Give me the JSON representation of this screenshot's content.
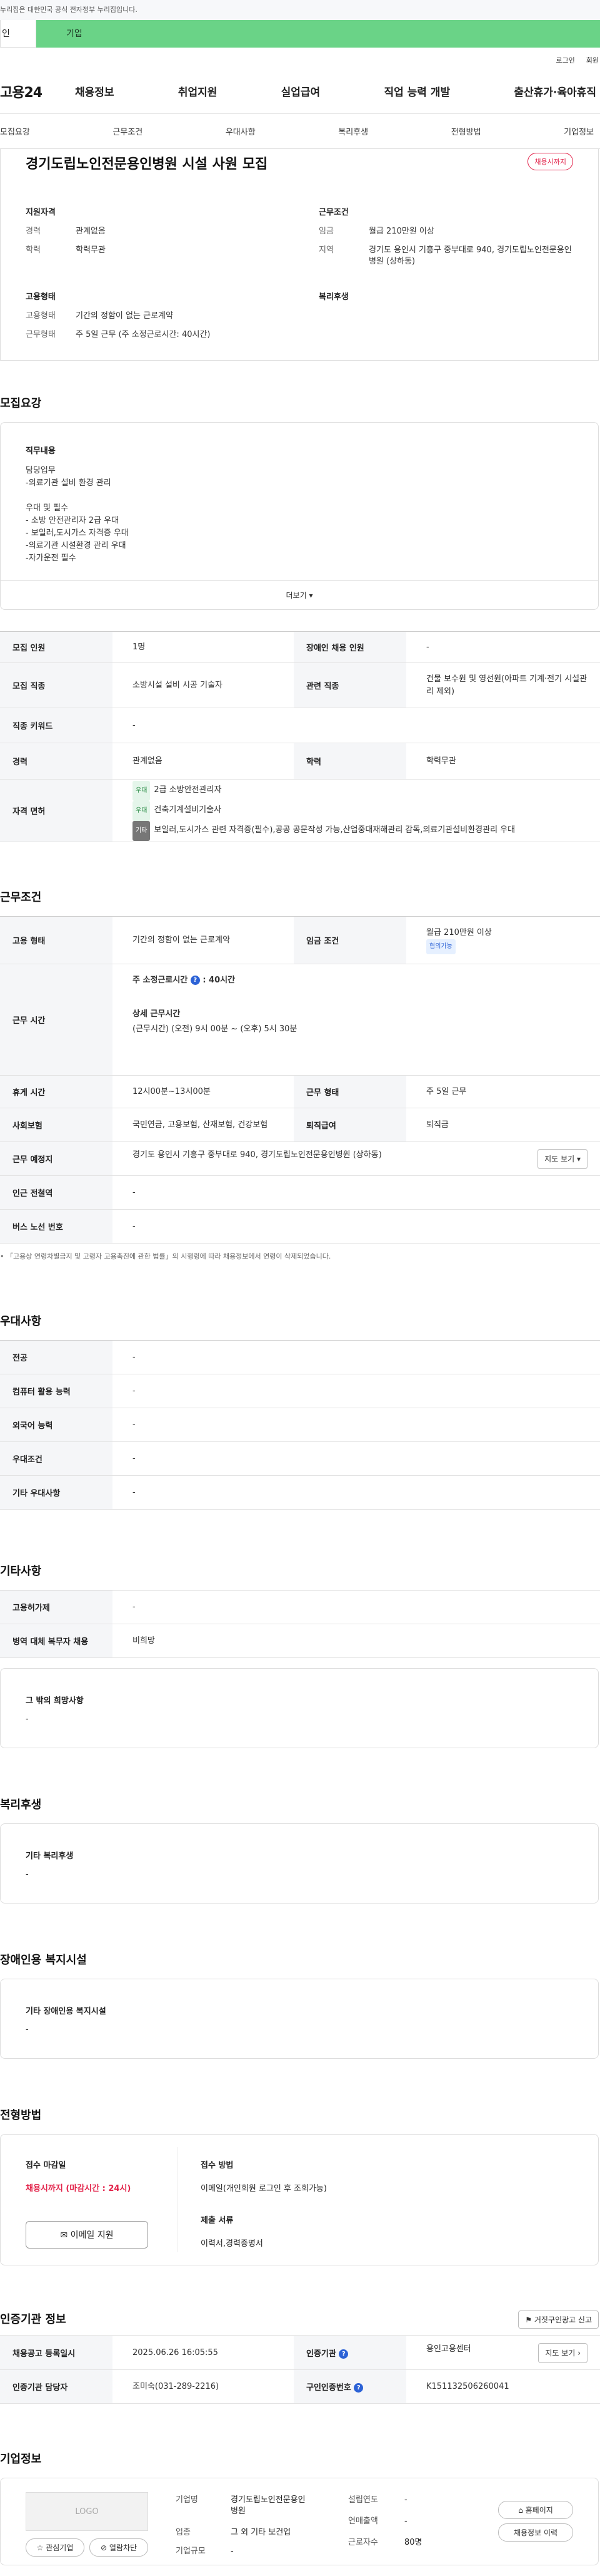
{
  "notice": "누리집은 대한민국 공식 전자정부 누리집입니다.",
  "user_tabs": [
    "인",
    "기업"
  ],
  "util_links": [
    "로그인",
    "회원"
  ],
  "logo": "고용24",
  "gnb": [
    "채용정보",
    "취업지원",
    "실업급여",
    "직업 능력 개발",
    "출산휴가·육아휴직"
  ],
  "subnav": [
    "모집요강",
    "근무조건",
    "우대사항",
    "복리후생",
    "전형방법",
    "기업정보"
  ],
  "job": {
    "title": "경기도립노인전문용인병원 시설 사원 모집",
    "status": "채용시까지",
    "qual_heading": "지원자격",
    "qual": [
      {
        "k": "경력",
        "v": "관계없음"
      },
      {
        "k": "학력",
        "v": "학력무관"
      }
    ],
    "cond_heading": "근무조건",
    "cond": [
      {
        "k": "임금",
        "v": "월급 210만원 이상"
      },
      {
        "k": "지역",
        "v": "경기도 용인시 기흥구 중부대로 940, 경기도립노인전문용인병원 (상하동)"
      }
    ],
    "emp_heading": "고용형태",
    "emp": [
      {
        "k": "고용형태",
        "v": "기간의 정함이 없는 근로계약"
      },
      {
        "k": "근무형태",
        "v": "주 5일 근무 (주 소정근로시간: 40시간)"
      }
    ],
    "welfare_heading": "복리후생"
  },
  "recruit": {
    "heading": "모집요강",
    "duty_label": "직무내용",
    "duty_lines": [
      "담당업무",
      "-의료기관 설비 환경 관리",
      "",
      "우대 및 필수",
      "- 소방 안전관리자 2급 우대",
      "- 보일러,도시가스 자격증 우대",
      "-의료기관 시설환경 관리 우대",
      "-자가운전 필수"
    ],
    "more": "더보기",
    "rows": {
      "headcount_k": "모집 인원",
      "headcount_v": "1명",
      "disabled_k": "장애인 채용 인원",
      "disabled_v": "-",
      "job_k": "모집 직종",
      "job_v": "소방시설 설비 시공 기술자",
      "rel_k": "관련 직종",
      "rel_v": "건물 보수원 및 영선원(아파트 기계·전기 시설관리 제외)",
      "kw_k": "직종 키워드",
      "kw_v": "-",
      "career_k": "경력",
      "career_v": "관계없음",
      "edu_k": "학력",
      "edu_v": "학력무관",
      "license_k": "자격 면허",
      "licenses": [
        {
          "tag": "우대",
          "name": "2급 소방안전관리자"
        },
        {
          "tag": "우대",
          "name": "건축기계설비기술사"
        },
        {
          "tag": "기타",
          "name": "보일러,도시가스 관련 자격증(필수),공공 공문작성 가능,산업중대재해관리 감독,의료기관설비환경관리 우대"
        }
      ]
    }
  },
  "work": {
    "heading": "근무조건",
    "type_k": "고용 형태",
    "type_v": "기간의 정함이 없는 근로계약",
    "wage_k": "임금 조건",
    "wage_v": "월급 210만원 이상",
    "wage_badge": "협의가능",
    "hours_k": "근무 시간",
    "hours_total_label": "주 소정근로시간",
    "hours_total": ": 40시간",
    "hours_detail_label": "상세 근무시간",
    "hours_detail": "(근무시간) (오전) 9시 00분 ~ (오후) 5시 30분",
    "break_k": "휴게 시간",
    "break_v": "12시00분~13시00분",
    "form_k": "근무 형태",
    "form_v": "주 5일 근무",
    "ins_k": "사회보험",
    "ins_v": "국민연금, 고용보험, 산재보험, 건강보험",
    "sev_k": "퇴직급여",
    "sev_v": "퇴직금",
    "place_k": "근무 예정지",
    "place_v": "경기도 용인시 기흥구 중부대로 940, 경기도립노인전문용인병원 (상하동)",
    "map_btn": "지도 보기",
    "station_k": "인근 전철역",
    "station_v": "-",
    "bus_k": "버스 노선 번호",
    "bus_v": "-",
    "note": "「고용상 연령차별금지 및 고령자 고용촉진에 관한 법률」의 시행령에 따라 채용정보에서 연령이 삭제되었습니다."
  },
  "pref": {
    "heading": "우대사항",
    "rows": [
      {
        "k": "전공",
        "v": "-"
      },
      {
        "k": "컴퓨터 활용 능력",
        "v": "-"
      },
      {
        "k": "외국어 능력",
        "v": "-"
      },
      {
        "k": "우대조건",
        "v": "-"
      },
      {
        "k": "기타 우대사항",
        "v": "-"
      }
    ]
  },
  "etc": {
    "heading": "기타사항",
    "rows": [
      {
        "k": "고용허가제",
        "v": "-"
      },
      {
        "k": "병역 대체 복무자 채용",
        "v": "비희망"
      }
    ],
    "other_label": "그 밖의 희망사항",
    "other_v": "-"
  },
  "welfare": {
    "heading": "복리후생",
    "label": "기타 복리후생",
    "value": "-"
  },
  "facility": {
    "heading": "장애인용 복지시설",
    "label": "기타 장애인용 복지시설",
    "value": "-"
  },
  "selection": {
    "heading": "전형방법",
    "deadline_label": "접수 마감일",
    "deadline": "채용시까지 (마감시간 : 24시)",
    "email_btn": "이메일 지원",
    "method_label": "접수 방법",
    "method": "이메일(개인회원 로그인 후 조회가능)",
    "docs_label": "제출 서류",
    "docs": "이력서,경력증명서"
  },
  "agency": {
    "heading": "인증기관 정보",
    "report_btn": "거짓구인광고 신고",
    "reg_k": "채용공고 등록일시",
    "reg_v": "2025.06.26 16:05:55",
    "org_k": "인증기관",
    "org_v": "용인고용센터",
    "map_btn": "지도 보기",
    "mgr_k": "인증기관 담당자",
    "mgr_v": "조미숙(031-289-2216)",
    "no_k": "구인인증번호",
    "no_v": "K151132506260041"
  },
  "company": {
    "heading": "기업정보",
    "logo": "LOGO",
    "fav_btn": "관심기업",
    "block_btn": "열람차단",
    "name_k": "기업명",
    "name_v": "경기도립노인전문용인병원",
    "ind_k": "업종",
    "ind_v": "그 외 기타 보건업",
    "size_k": "기업규모",
    "size_v": "-",
    "est_k": "설립연도",
    "est_v": "-",
    "sales_k": "연매출액",
    "sales_v": "-",
    "emp_k": "근로자수",
    "emp_v": "80명",
    "home_btn": "홈페이지",
    "hist_btn": "채용정보 이력"
  }
}
